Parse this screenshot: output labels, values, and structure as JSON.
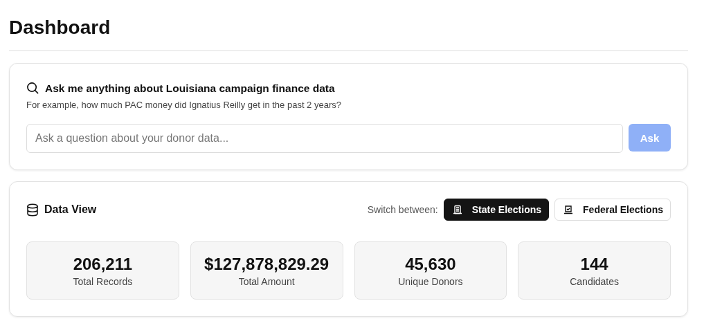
{
  "page": {
    "title": "Dashboard"
  },
  "ask": {
    "title": "Ask me anything about Louisiana campaign finance data",
    "example": "For example, how much PAC money did Ignatius Reilly get in the past 2 years?",
    "placeholder": "Ask a question about your donor data...",
    "button": "Ask",
    "button_disabled": true
  },
  "data_view": {
    "title": "Data View",
    "switch_label": "Switch between:",
    "options": [
      {
        "label": "State Elections",
        "kind": "building",
        "selected": true
      },
      {
        "label": "Federal Elections",
        "kind": "ballot",
        "selected": false
      }
    ],
    "stats": [
      {
        "value": "206,211",
        "label": "Total Records"
      },
      {
        "value": "$127,878,829.29",
        "label": "Total Amount"
      },
      {
        "value": "45,630",
        "label": "Unique Donors"
      },
      {
        "value": "144",
        "label": "Candidates"
      }
    ]
  }
}
